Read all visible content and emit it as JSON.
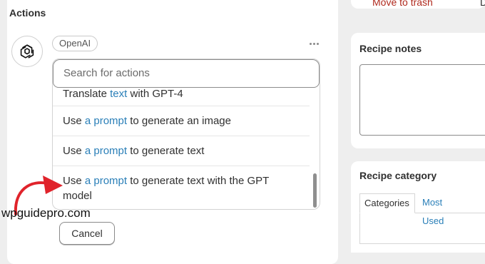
{
  "actions": {
    "title": "Actions",
    "app_icon": "openai-logo-icon",
    "chip_label": "OpenAI",
    "more_icon": "more-dots-icon",
    "search": {
      "placeholder": "Search for actions"
    },
    "options": [
      {
        "pre": "Translate ",
        "link": "text",
        "post": " with GPT-4"
      },
      {
        "pre": "Use ",
        "link": "a prompt",
        "post": " to generate an image"
      },
      {
        "pre": "Use ",
        "link": "a prompt",
        "post": " to generate text"
      },
      {
        "pre": "Use ",
        "link": "a prompt",
        "post": " to generate text with the GPT model"
      }
    ],
    "cancel_label": "Cancel"
  },
  "watermark": "wpguidepro.com",
  "sidebar": {
    "trash_label": "Move to trash",
    "cut_text": "D",
    "notes_title": "Recipe notes",
    "category_title": "Recipe category",
    "tabs": [
      "Categories",
      "Most Used"
    ]
  },
  "colors": {
    "link": "#2a7fb8",
    "trash": "#b02a1e",
    "arrow": "#e0232b",
    "background": "#eeeeee"
  }
}
